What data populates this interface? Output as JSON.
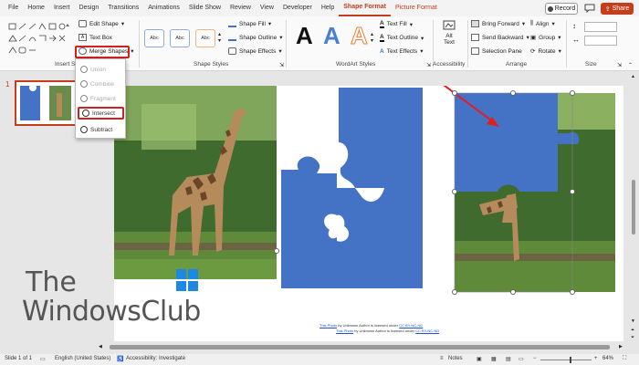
{
  "menu": {
    "items": [
      "File",
      "Home",
      "Insert",
      "Design",
      "Transitions",
      "Animations",
      "Slide Show",
      "Review",
      "View",
      "Developer",
      "Help",
      "Shape Format",
      "Picture Format"
    ],
    "active": "Shape Format",
    "record_label": "Record",
    "share_label": "Share"
  },
  "ribbon": {
    "insert_shapes_label": "Insert Shapes",
    "edit_shape_label": "Edit Shape",
    "text_box_label": "Text Box",
    "merge_shapes_label": "Merge Shapes",
    "shape_styles_label": "Shape Styles",
    "style_preset": "Abc",
    "shape_fill_label": "Shape Fill",
    "shape_outline_label": "Shape Outline",
    "shape_effects_label": "Shape Effects",
    "wordart_label": "WordArt Styles",
    "wordart_letter": "A",
    "text_fill_label": "Text Fill",
    "text_outline_label": "Text Outline",
    "text_effects_label": "Text Effects",
    "alt_text_line1": "Alt",
    "alt_text_line2": "Text",
    "accessibility_label": "Accessibility",
    "bring_forward_label": "Bring Forward",
    "send_backward_label": "Send Backward",
    "selection_pane_label": "Selection Pane",
    "align_label": "Align",
    "group_label": "Group",
    "rotate_label": "Rotate",
    "arrange_label": "Arrange",
    "size_label": "Size"
  },
  "merge_menu": {
    "items": [
      {
        "label": "Union",
        "enabled": false
      },
      {
        "label": "Combine",
        "enabled": false
      },
      {
        "label": "Fragment",
        "enabled": false
      },
      {
        "label": "Intersect",
        "enabled": true,
        "highlighted": true
      },
      {
        "label": "Subtract",
        "enabled": true
      }
    ]
  },
  "slide_pane": {
    "slide_number": "1"
  },
  "slide": {
    "credit_line1_link": "This Photo",
    "credit_line1_text": " by Unknown Author is licensed under ",
    "credit_line1_license": "CC BY-NC-ND",
    "credit_line2_link": "This Photo",
    "credit_line2_text": " by Unknown Author is licensed under ",
    "credit_line2_license": "CC BY-NC-ND",
    "puzzle_color": "#4472c4"
  },
  "watermark": {
    "line1": "The",
    "line2": "WindowsClub"
  },
  "statusbar": {
    "slide_info": "Slide 1 of 1",
    "language": "English (United States)",
    "accessibility": "Accessibility: Investigate",
    "notes_label": "Notes",
    "zoom": "64%"
  },
  "colors": {
    "accent": "#c43e1c",
    "highlight_red": "#d02020",
    "arrow_red": "#e02020"
  }
}
